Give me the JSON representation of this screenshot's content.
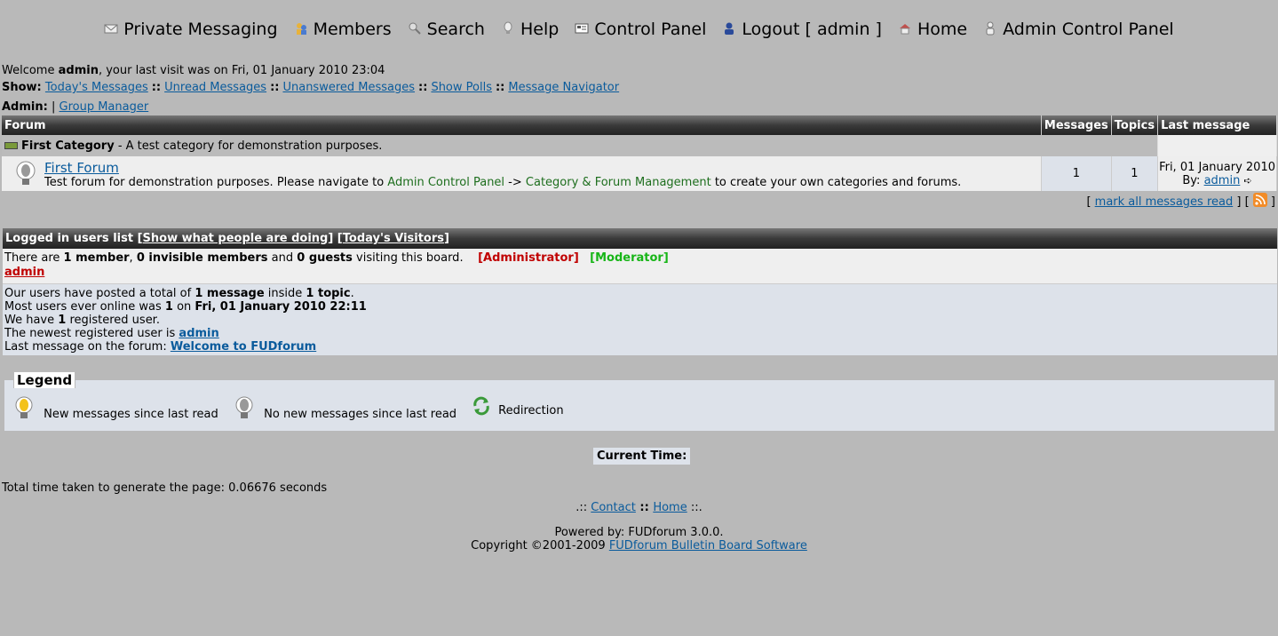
{
  "nav": {
    "items": [
      {
        "label": "Private Messaging",
        "icon": "envelope-icon"
      },
      {
        "label": "Members",
        "icon": "members-icon"
      },
      {
        "label": "Search",
        "icon": "search-icon"
      },
      {
        "label": "Help",
        "icon": "help-icon"
      },
      {
        "label": "Control Panel",
        "icon": "control-panel-icon"
      },
      {
        "label": "Logout [ admin ]",
        "icon": "logout-icon"
      },
      {
        "label": "Home",
        "icon": "home-icon"
      },
      {
        "label": "Admin Control Panel",
        "icon": "admin-icon"
      }
    ]
  },
  "welcome": {
    "prefix": "Welcome ",
    "user": "admin",
    "suffix": ", your last visit was on Fri, 01 January 2010 23:04"
  },
  "show": {
    "label": "Show:",
    "links": [
      "Today's Messages",
      "Unread Messages",
      "Unanswered Messages",
      "Show Polls",
      "Message Navigator"
    ],
    "separator": "::"
  },
  "admin": {
    "label": "Admin:",
    "pipe": "|",
    "link": "Group Manager"
  },
  "forum_table": {
    "headers": [
      "Forum",
      "Messages",
      "Topics",
      "Last message"
    ],
    "category": {
      "name": "First Category",
      "desc": " - A test category for demonstration purposes."
    },
    "forum": {
      "name": "First Forum",
      "desc_start": "Test forum for demonstration purposes. Please navigate to ",
      "link1": "Admin Control Panel",
      "arrow": " -> ",
      "link2": "Category & Forum Management",
      "desc_end": " to create your own categories and forums.",
      "messages": "1",
      "topics": "1",
      "last_date": "Fri, 01 January 2010",
      "last_by": "By: ",
      "last_user": "admin"
    },
    "mark_read": "mark all messages read",
    "bracket_open": "[",
    "bracket_mid": "] [",
    "bracket_close": "]"
  },
  "logged": {
    "title": "Logged in users list",
    "link1": "Show what people are doing",
    "link2": "Today's Visitors",
    "line1_a": "There are ",
    "line1_b": "1 member",
    "line1_c": ", ",
    "line1_d": "0 invisible members",
    "line1_e": " and ",
    "line1_f": "0 guests",
    "line1_g": " visiting this board.",
    "role_admin": "[Administrator]",
    "role_mod": "[Moderator]",
    "online_user": "admin",
    "stats": {
      "l1a": "Our users have posted a total of ",
      "l1b": "1 message",
      "l1c": " inside ",
      "l1d": "1 topic",
      "l1e": ".",
      "l2a": "Most users ever online was ",
      "l2b": "1",
      "l2c": " on ",
      "l2d": "Fri, 01 January 2010 22:11",
      "l3a": "We have ",
      "l3b": "1",
      "l3c": " registered user.",
      "l4a": "The newest registered user is ",
      "l4b": "admin",
      "l5a": "Last message on the forum: ",
      "l5b": "Welcome to FUDforum"
    }
  },
  "legend": {
    "title": "Legend",
    "new": "New messages since last read",
    "nonew": "No new messages since last read",
    "redirect": "Redirection"
  },
  "current_time": "Current Time:",
  "gen_time": "Total time taken to generate the page: 0.06676 seconds",
  "footer": {
    "pre": ".:: ",
    "contact": "Contact",
    "sep": " :: ",
    "home": "Home",
    "post": " ::.",
    "powered": "Powered by: FUDforum 3.0.0.",
    "copyright": "Copyright ©2001-2009 ",
    "software": "FUDforum Bulletin Board Software"
  }
}
